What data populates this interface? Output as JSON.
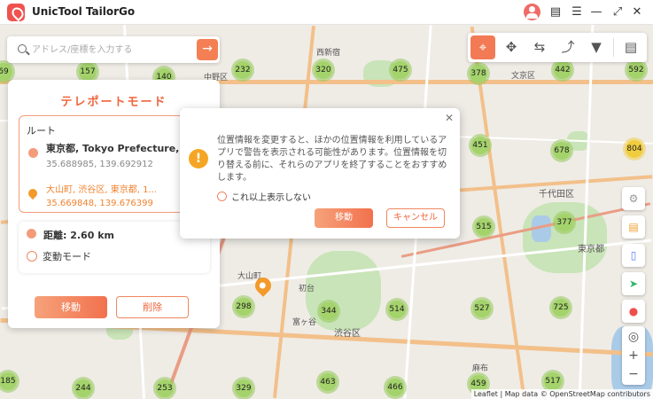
{
  "app": {
    "title": "UnicTool TailorGo"
  },
  "window": {
    "user_icon": "user-icon",
    "message_icon": "message-icon",
    "menu_icon": "menu-icon",
    "minimize_icon": "minimize-icon",
    "maximize_icon": "maximize-icon",
    "close_icon": "close-icon"
  },
  "search": {
    "placeholder": "アドレス/座標を入力する",
    "value": ""
  },
  "toolbar": {
    "modes": [
      "teleport-mode",
      "joystick-mode",
      "two-spot-mode",
      "multi-spot-mode",
      "jump-teleport-mode",
      "history"
    ],
    "active": "teleport-mode",
    "accent": "#f27a55"
  },
  "panel": {
    "title": "テレポートモード",
    "route_label": "ルート",
    "start": {
      "name": "東京都, Tokyo Prefecture, Japan",
      "coords": "35.688985, 139.692912"
    },
    "end": {
      "name": "大山町, 渋谷区, 東京都, 1...",
      "coords": "35.669848, 139.676399"
    },
    "distance": "距離:  2.60 km",
    "variable_mode": "変動モード",
    "move_button": "移動",
    "delete_button": "削除"
  },
  "dialog": {
    "message": "位置情報を変更すると、ほかの位置情報を利用しているアプリで警告を表示される可能性があります。位置情報を切り替える前に、それらのアプリを終了することをおすすめします。",
    "dont_show": "これ以上表示しない",
    "move_button": "移動",
    "cancel_button": "キャンセル"
  },
  "map": {
    "labels": [
      "中野区",
      "文京区",
      "千代田区",
      "東京都",
      "渋谷区",
      "西新宿",
      "初台",
      "富ヶ谷",
      "麻布",
      "大山町"
    ],
    "clusters": [
      {
        "value": "69"
      },
      {
        "value": "157"
      },
      {
        "value": "140"
      },
      {
        "value": "232"
      },
      {
        "value": "320"
      },
      {
        "value": "475"
      },
      {
        "value": "378"
      },
      {
        "value": "442"
      },
      {
        "value": "592"
      },
      {
        "value": "451"
      },
      {
        "value": "678"
      },
      {
        "value": "804"
      },
      {
        "value": "515"
      },
      {
        "value": "377"
      },
      {
        "value": "298"
      },
      {
        "value": "344"
      },
      {
        "value": "514"
      },
      {
        "value": "527"
      },
      {
        "value": "725"
      },
      {
        "value": "185"
      },
      {
        "value": "244"
      },
      {
        "value": "253"
      },
      {
        "value": "329"
      },
      {
        "value": "463"
      },
      {
        "value": "466"
      },
      {
        "value": "459"
      },
      {
        "value": "517"
      }
    ],
    "attribution": "Leaflet | Map data © OpenStreetMap contributors",
    "side_tools": [
      "settings-icon",
      "folder-icon",
      "phone-icon",
      "send-icon",
      "toggle-icon"
    ],
    "zoom": {
      "locate": "locate-icon",
      "in": "+",
      "out": "−"
    }
  }
}
